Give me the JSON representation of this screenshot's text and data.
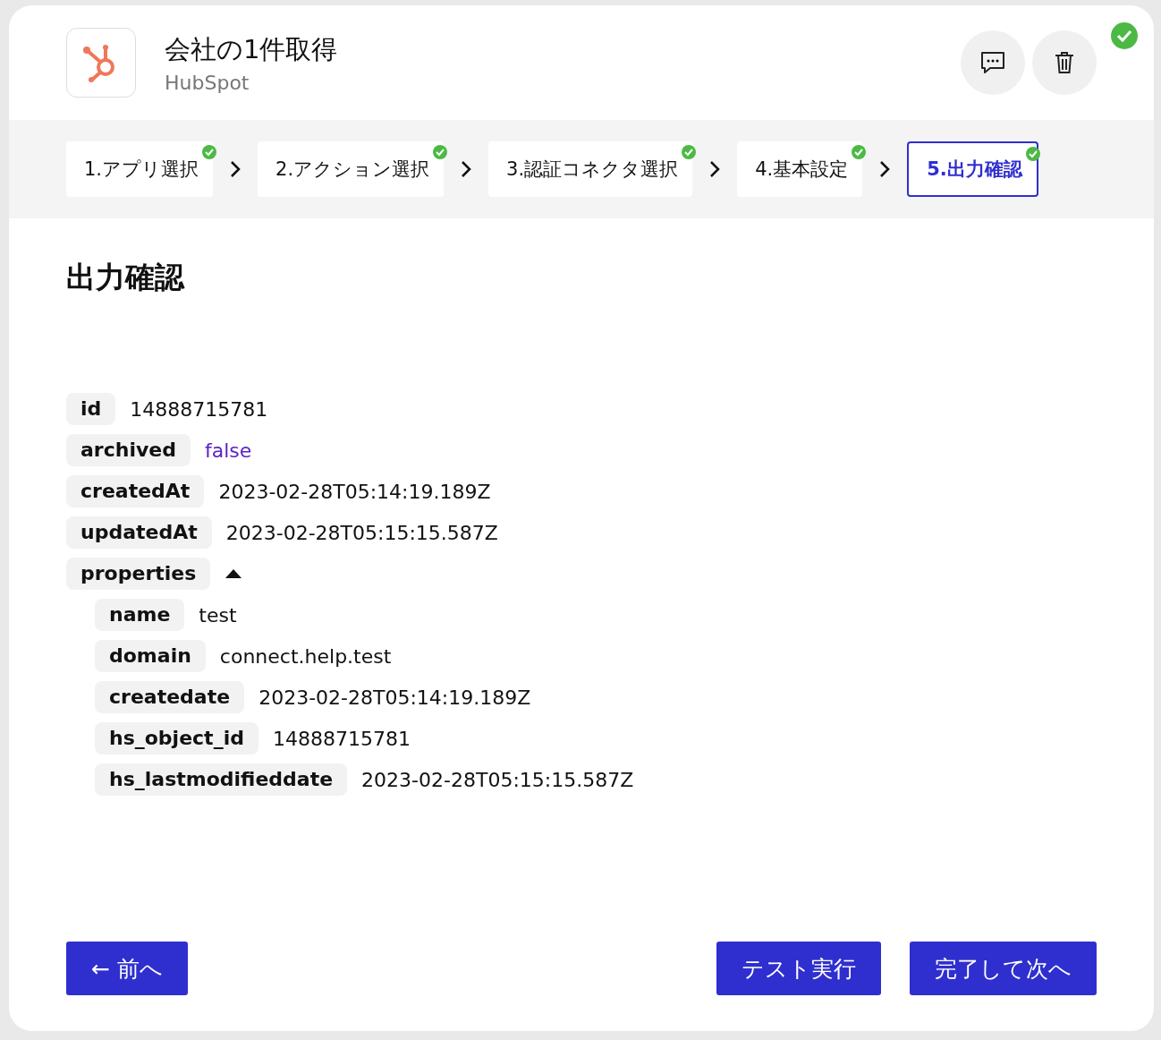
{
  "header": {
    "title": "会社の1件取得",
    "app": "HubSpot",
    "done": true
  },
  "steps": [
    {
      "label": "1.アプリ選択",
      "done": true,
      "selected": false
    },
    {
      "label": "2.アクション選択",
      "done": true,
      "selected": false
    },
    {
      "label": "3.認証コネクタ選択",
      "done": true,
      "selected": false
    },
    {
      "label": "4.基本設定",
      "done": true,
      "selected": false
    },
    {
      "label": "5.出力確認",
      "done": true,
      "selected": true
    }
  ],
  "section_title": "出力確認",
  "fields": [
    {
      "key": "id",
      "value": "14888715781",
      "kind": "text"
    },
    {
      "key": "archived",
      "value": "false",
      "kind": "boolean"
    },
    {
      "key": "createdAt",
      "value": "2023-02-28T05:14:19.189Z",
      "kind": "text"
    },
    {
      "key": "updatedAt",
      "value": "2023-02-28T05:15:15.587Z",
      "kind": "text"
    },
    {
      "key": "properties",
      "kind": "object",
      "expanded": true,
      "children": [
        {
          "key": "name",
          "value": "test"
        },
        {
          "key": "domain",
          "value": "connect.help.test"
        },
        {
          "key": "createdate",
          "value": "2023-02-28T05:14:19.189Z"
        },
        {
          "key": "hs_object_id",
          "value": "14888715781"
        },
        {
          "key": "hs_lastmodifieddate",
          "value": "2023-02-28T05:15:15.587Z"
        }
      ]
    }
  ],
  "buttons": {
    "back": "← 前へ",
    "test": "テスト実行",
    "next": "完了して次へ"
  }
}
